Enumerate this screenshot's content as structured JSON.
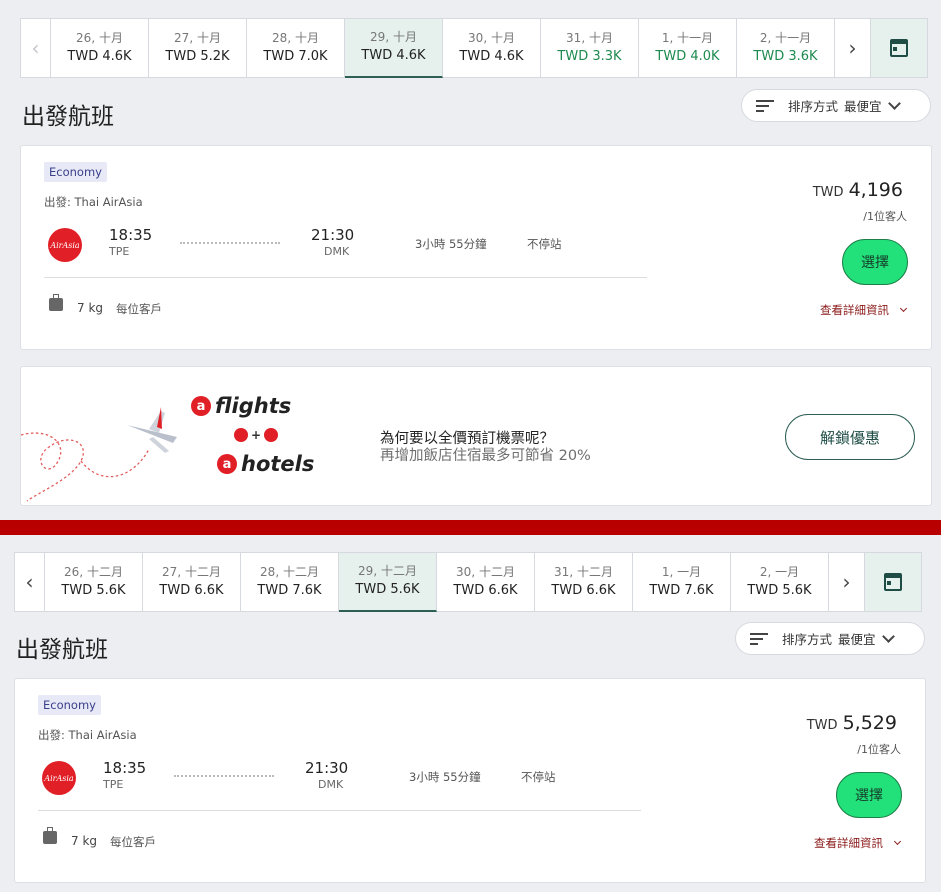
{
  "panel1": {
    "dates": [
      {
        "date": "26, 十月",
        "price": "TWD 4.6K",
        "cheap": false,
        "active": false
      },
      {
        "date": "27, 十月",
        "price": "TWD 5.2K",
        "cheap": false,
        "active": false
      },
      {
        "date": "28, 十月",
        "price": "TWD 7.0K",
        "cheap": false,
        "active": false
      },
      {
        "date": "29, 十月",
        "price": "TWD 4.6K",
        "cheap": false,
        "active": true
      },
      {
        "date": "30, 十月",
        "price": "TWD 4.6K",
        "cheap": false,
        "active": false
      },
      {
        "date": "31, 十月",
        "price": "TWD 3.3K",
        "cheap": true,
        "active": false
      },
      {
        "date": "1, 十一月",
        "price": "TWD 4.0K",
        "cheap": true,
        "active": false
      },
      {
        "date": "2, 十一月",
        "price": "TWD 3.6K",
        "cheap": true,
        "active": false
      }
    ],
    "title": "出發航班",
    "sort": {
      "label": "排序方式",
      "value": "最便宜"
    },
    "flight": {
      "cabin": "Economy",
      "carrier": "出發: Thai AirAsia",
      "logo_text": "AirAsia",
      "dep_time": "18:35",
      "dep_code": "TPE",
      "arr_time": "21:30",
      "arr_code": "DMK",
      "duration": "3小時 55分鐘",
      "stops": "不停站",
      "baggage_weight": "7 kg",
      "baggage_per": "每位客戶",
      "currency": "TWD",
      "price": "4,196",
      "per_pax": "/1位客人",
      "select": "選擇",
      "details": "查看詳細資訊"
    },
    "promo": {
      "brand_flights": "flights",
      "brand_hotels": "hotels",
      "brand_mark": "a",
      "question": "為何要以全價預訂機票呢？",
      "subtitle": "再增加飯店住宿最多可節省 20%",
      "button": "解鎖優惠"
    }
  },
  "panel2": {
    "dates": [
      {
        "date": "26, 十二月",
        "price": "TWD 5.6K",
        "cheap": false,
        "active": false
      },
      {
        "date": "27, 十二月",
        "price": "TWD 6.6K",
        "cheap": false,
        "active": false
      },
      {
        "date": "28, 十二月",
        "price": "TWD 7.6K",
        "cheap": false,
        "active": false
      },
      {
        "date": "29, 十二月",
        "price": "TWD 5.6K",
        "cheap": false,
        "active": true
      },
      {
        "date": "30, 十二月",
        "price": "TWD 6.6K",
        "cheap": false,
        "active": false
      },
      {
        "date": "31, 十二月",
        "price": "TWD 6.6K",
        "cheap": false,
        "active": false
      },
      {
        "date": "1, 一月",
        "price": "TWD 7.6K",
        "cheap": false,
        "active": false
      },
      {
        "date": "2, 一月",
        "price": "TWD 5.6K",
        "cheap": false,
        "active": false
      }
    ],
    "title": "出發航班",
    "sort": {
      "label": "排序方式",
      "value": "最便宜"
    },
    "flight": {
      "cabin": "Economy",
      "carrier": "出發: Thai AirAsia",
      "logo_text": "AirAsia",
      "dep_time": "18:35",
      "dep_code": "TPE",
      "arr_time": "21:30",
      "arr_code": "DMK",
      "duration": "3小時 55分鐘",
      "stops": "不停站",
      "baggage_weight": "7 kg",
      "baggage_per": "每位客戶",
      "currency": "TWD",
      "price": "5,529",
      "per_pax": "/1位客人",
      "select": "選擇",
      "details": "查看詳細資訊"
    }
  },
  "colors": {
    "accent_green": "#22e07a",
    "cheap_price": "#1e8a4f",
    "active_bg": "#e6f1ee",
    "divider": "#b80000",
    "airasia_red": "#e11f26",
    "details_link": "#8b1a1a"
  },
  "icons": {
    "prev": "chevron-left-icon",
    "next": "chevron-right-icon",
    "calendar": "calendar-icon",
    "sort": "sort-icon",
    "baggage": "baggage-icon"
  }
}
